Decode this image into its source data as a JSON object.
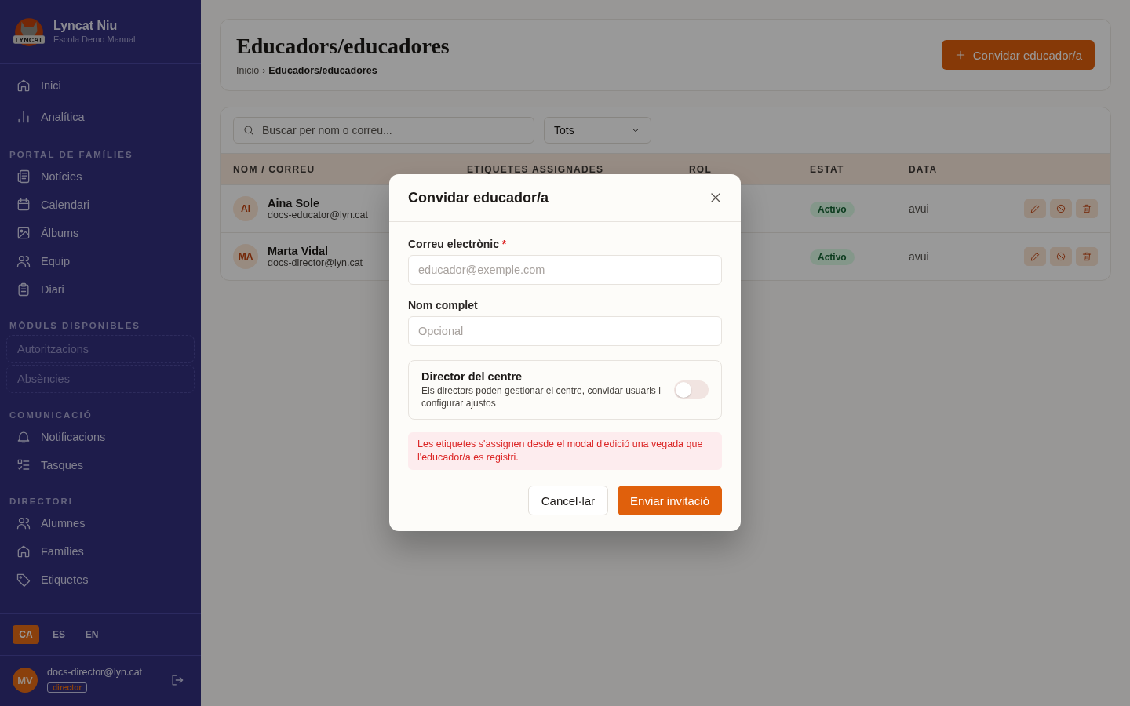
{
  "sidebar": {
    "brand": {
      "logo_text": "LYNCAT",
      "name": "Lyncat Niu",
      "subtitle": "Escola Demo Manual"
    },
    "sections": [
      {
        "items": [
          {
            "label": "Inici",
            "kind": "link"
          },
          {
            "label": "Analítica",
            "kind": "link"
          }
        ]
      },
      {
        "title": "PORTAL DE FAMÍLIES",
        "items": [
          {
            "label": "Notícies",
            "kind": "link"
          },
          {
            "label": "Calendari",
            "kind": "link"
          },
          {
            "label": "Àlbums",
            "kind": "link"
          },
          {
            "label": "Equip",
            "kind": "link"
          },
          {
            "label": "Diari",
            "kind": "link"
          }
        ]
      },
      {
        "title": "MÒDULS DISPONIBLES",
        "items": [
          {
            "label": "Autoritzacions",
            "kind": "module"
          },
          {
            "label": "Absències",
            "kind": "module"
          }
        ]
      },
      {
        "title": "COMUNICACIÓ",
        "items": [
          {
            "label": "Notificacions",
            "kind": "link"
          },
          {
            "label": "Tasques",
            "kind": "link"
          }
        ]
      },
      {
        "title": "DIRECTORI",
        "items": [
          {
            "label": "Alumnes",
            "kind": "link"
          },
          {
            "label": "Famílies",
            "kind": "link"
          },
          {
            "label": "Etiquetes",
            "kind": "link"
          }
        ]
      }
    ],
    "languages": [
      {
        "label": "CA",
        "selected": true
      },
      {
        "label": "ES",
        "selected": false
      },
      {
        "label": "EN",
        "selected": false
      }
    ],
    "user": {
      "initials": "MV",
      "email": "docs-director@lyn.cat",
      "role": "director"
    }
  },
  "header": {
    "title": "Educadors/educadores",
    "breadcrumb": [
      {
        "label": "Inicio",
        "current": false
      },
      {
        "label": "Educadors/educadores",
        "current": true
      }
    ],
    "breadcrumb_separator": "›",
    "primary_button": "Convidar educador/a"
  },
  "filters": {
    "search_placeholder": "Buscar per nom o correu...",
    "role_select": "Tots"
  },
  "table": {
    "columns": [
      "NOM / CORREU",
      "ETIQUETES ASSIGNADES",
      "ROL",
      "ESTAT",
      "DATA"
    ],
    "rows": [
      {
        "initials": "AI",
        "name": "Aina Sole",
        "email": "docs-educator@lyn.cat",
        "status": "Activo",
        "date": "avui"
      },
      {
        "initials": "MA",
        "name": "Marta Vidal",
        "email": "docs-director@lyn.cat",
        "status": "Activo",
        "date": "avui"
      }
    ]
  },
  "modal": {
    "title": "Convidar educador/a",
    "fields": [
      {
        "label": "Correu electrònic",
        "required_mark": "*",
        "placeholder": "educador@exemple.com"
      },
      {
        "label": "Nom complet",
        "placeholder": "Opcional"
      }
    ],
    "toggle": {
      "title": "Director del centre",
      "description": "Els directors poden gestionar el centre, convidar usuaris i configurar ajustos",
      "on": false
    },
    "notice": "Les etiquetes s'assignen desde el modal d'edició una vegada que l'educador/a es registri.",
    "buttons": [
      {
        "label": "Cancel·lar",
        "kind": "secondary"
      },
      {
        "label": "Enviar invitació",
        "kind": "primary"
      }
    ]
  }
}
